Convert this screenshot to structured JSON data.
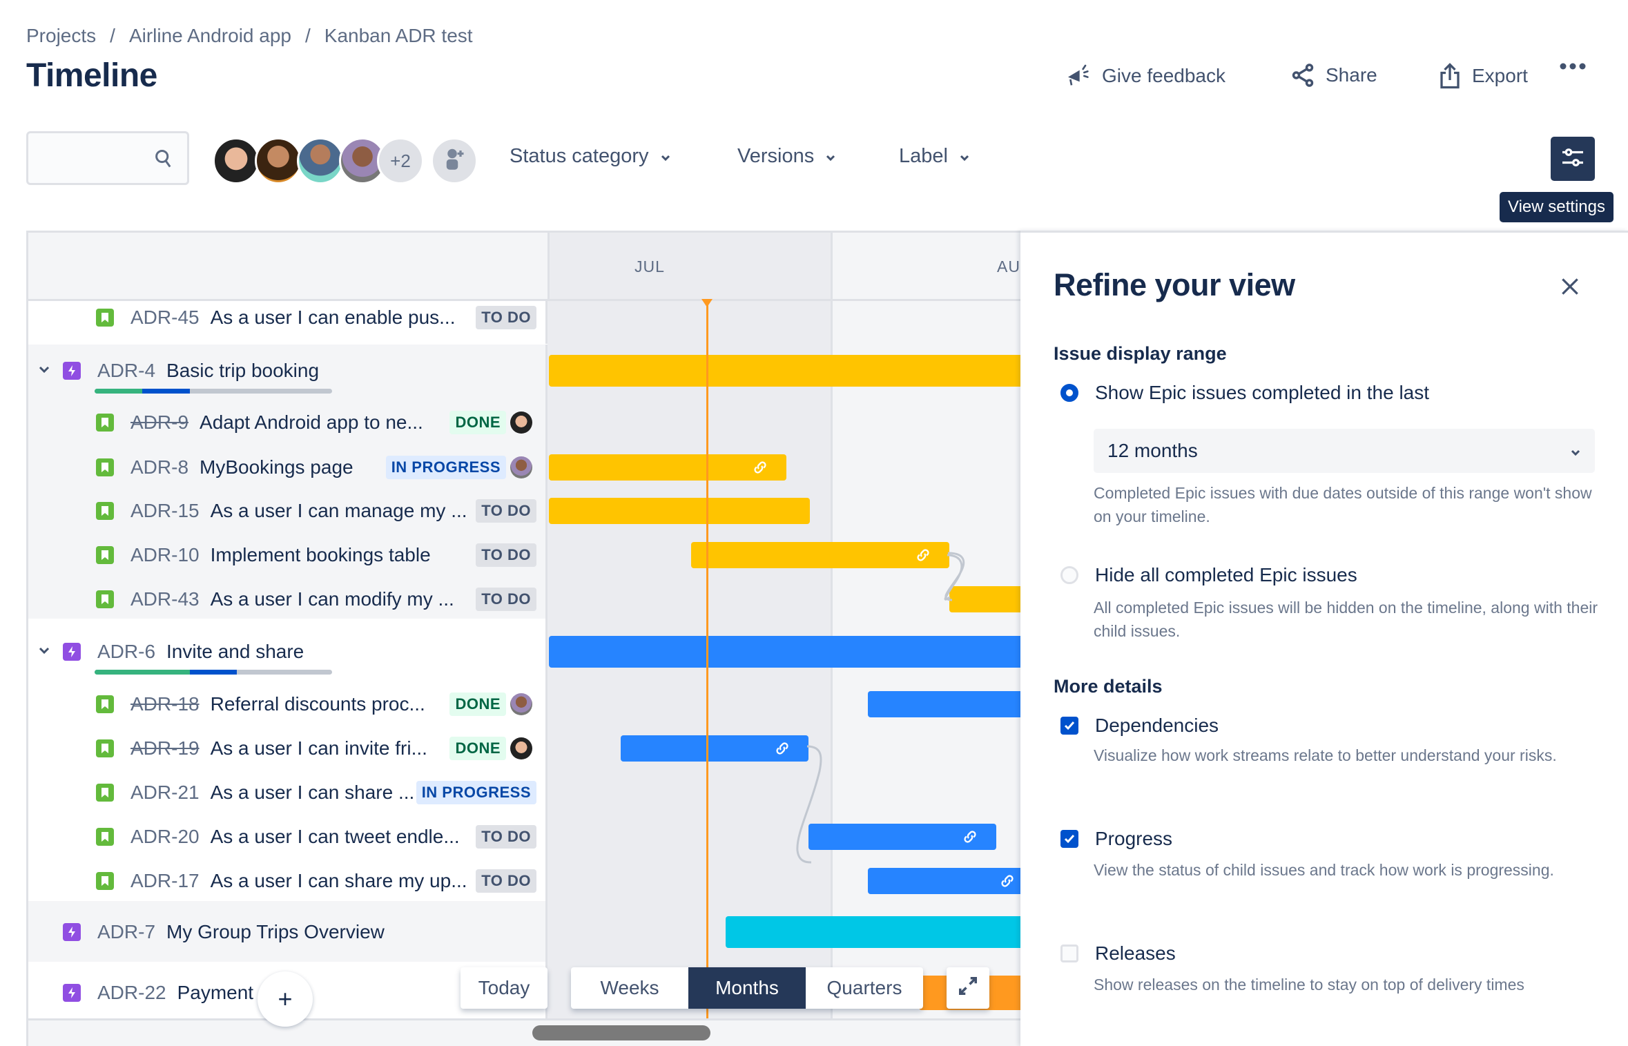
{
  "breadcrumb": [
    "Projects",
    "Airline Android app",
    "Kanban ADR test"
  ],
  "page_title": "Timeline",
  "actions": {
    "give_feedback": "Give feedback",
    "share": "Share",
    "export": "Export",
    "more_icon": "more-horizontal-icon"
  },
  "toolbar": {
    "search_placeholder": "",
    "avatars_more": "+2",
    "filters": [
      "Status category",
      "Versions",
      "Label"
    ],
    "view_settings_tooltip": "View settings"
  },
  "timeline": {
    "months": [
      "JUL",
      "AUG"
    ],
    "today_label": "Today",
    "scale_options": [
      "Weeks",
      "Months",
      "Quarters"
    ],
    "selected_scale": "Months",
    "colors": {
      "epic_yellow": "#ffc400",
      "epic_blue": "#2684ff",
      "epic_teal": "#00c7e6",
      "epic_orange": "#ff991f",
      "today_line": "#ff991f"
    },
    "rows": [
      {
        "type": "story",
        "key": "ADR-45",
        "summary": "As a user I can enable pus...",
        "status": "TO DO",
        "done": false
      },
      {
        "type": "epic",
        "key": "ADR-4",
        "summary": "Basic trip booking",
        "expanded": true,
        "progress": {
          "done": 0.2,
          "in_progress": 0.2,
          "todo": 0.6
        }
      },
      {
        "type": "story",
        "key": "ADR-9",
        "summary": "Adapt Android app to ne...",
        "status": "DONE",
        "done": true,
        "assignee": "woman"
      },
      {
        "type": "story",
        "key": "ADR-8",
        "summary": "MyBookings page",
        "status": "IN PROGRESS",
        "done": false,
        "assignee": "man"
      },
      {
        "type": "story",
        "key": "ADR-15",
        "summary": "As a user I can manage my ...",
        "status": "TO DO",
        "done": false
      },
      {
        "type": "story",
        "key": "ADR-10",
        "summary": "Implement bookings table",
        "status": "TO DO",
        "done": false
      },
      {
        "type": "story",
        "key": "ADR-43",
        "summary": "As a user I can modify my ...",
        "status": "TO DO",
        "done": false
      },
      {
        "type": "epic",
        "key": "ADR-6",
        "summary": "Invite and share",
        "expanded": true,
        "progress": {
          "done": 0.4,
          "in_progress": 0.2,
          "todo": 0.4
        }
      },
      {
        "type": "story",
        "key": "ADR-18",
        "summary": "Referral discounts proc...",
        "status": "DONE",
        "done": true,
        "assignee": "man"
      },
      {
        "type": "story",
        "key": "ADR-19",
        "summary": "As a user I can invite fri...",
        "status": "DONE",
        "done": true,
        "assignee": "woman"
      },
      {
        "type": "story",
        "key": "ADR-21",
        "summary": "As a user I can share ...",
        "status": "IN PROGRESS",
        "done": false
      },
      {
        "type": "story",
        "key": "ADR-20",
        "summary": "As a user I can tweet endle...",
        "status": "TO DO",
        "done": false
      },
      {
        "type": "story",
        "key": "ADR-17",
        "summary": "As a user I can share my up...",
        "status": "TO DO",
        "done": false
      },
      {
        "type": "epic",
        "key": "ADR-7",
        "summary": "My Group Trips Overview",
        "expanded": false
      },
      {
        "type": "epic",
        "key": "ADR-22",
        "summary": "Payment ...g",
        "expanded": false
      }
    ]
  },
  "panel": {
    "title": "Refine your view",
    "issue_display_range": {
      "heading": "Issue display range",
      "options": [
        {
          "label": "Show Epic issues completed in the last",
          "selected": true,
          "select_value": "12 months",
          "description": "Completed Epic issues with due dates outside of this range won't show on your timeline."
        },
        {
          "label": "Hide all completed Epic issues",
          "selected": false,
          "description": "All completed Epic issues will be hidden on the timeline, along with their child issues."
        }
      ]
    },
    "more_details": {
      "heading": "More details",
      "options": [
        {
          "label": "Dependencies",
          "checked": true,
          "description": "Visualize how work streams relate to better understand your risks."
        },
        {
          "label": "Progress",
          "checked": true,
          "description": "View the status of child issues and track how work is progressing."
        },
        {
          "label": "Releases",
          "checked": false,
          "description": "Show releases on the timeline to stay on top of delivery times"
        }
      ]
    }
  }
}
